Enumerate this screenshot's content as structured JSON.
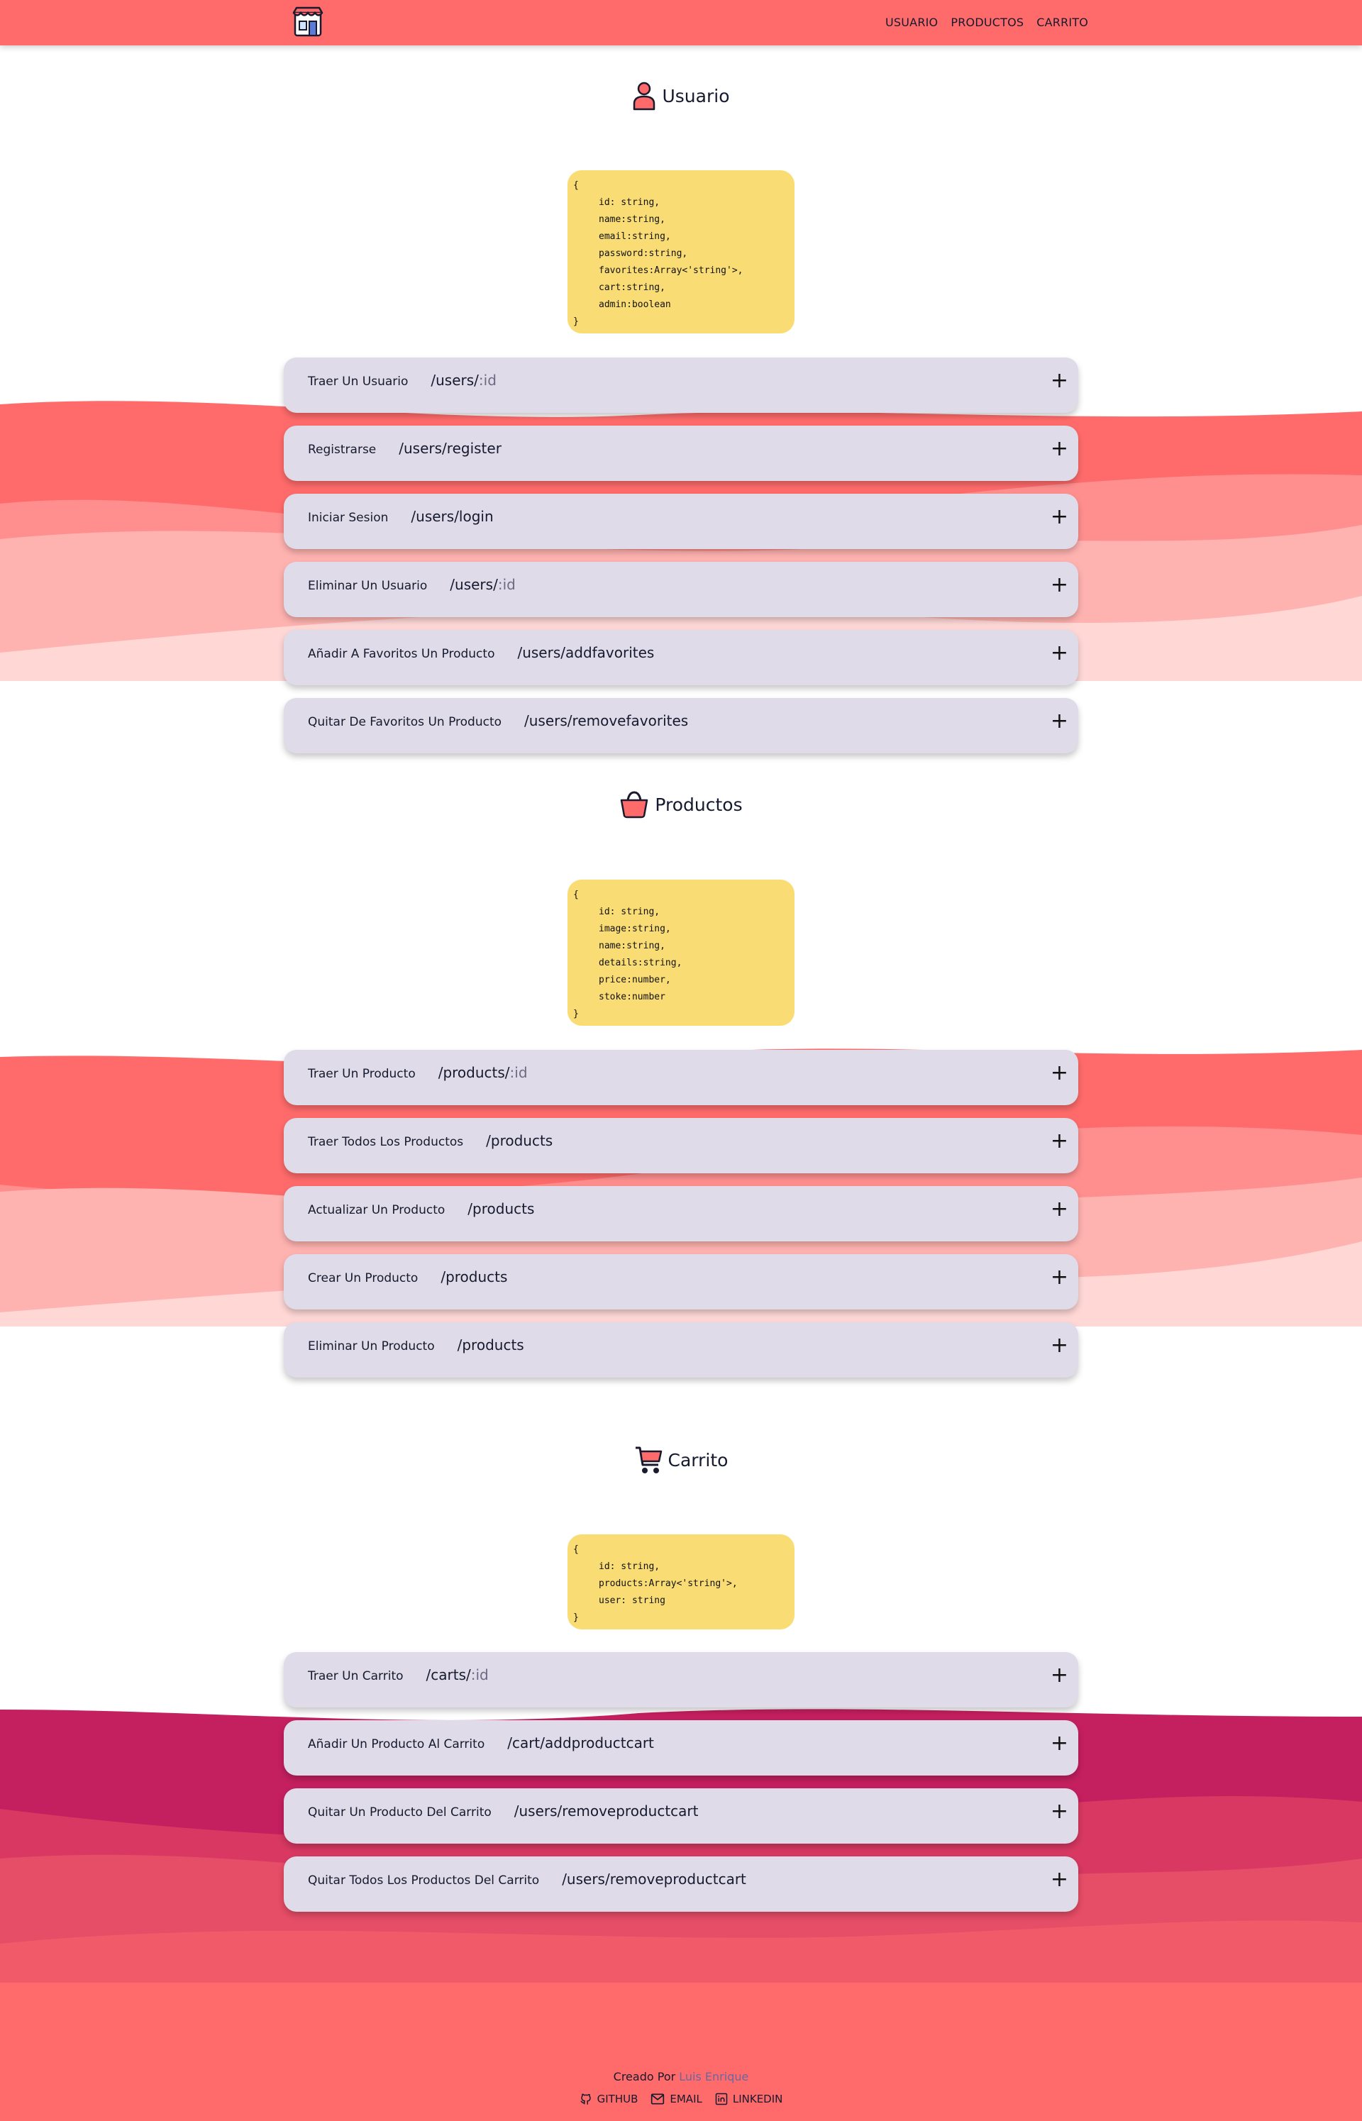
{
  "nav": {
    "logo_alt": "store-logo",
    "items": [
      "USUARIO",
      "PRODUCTOS",
      "CARRITO"
    ]
  },
  "sections": {
    "usuario": {
      "title": "Usuario",
      "schema": [
        "id: string,",
        "name:string,",
        "email:string,",
        "password:string,",
        "favorites:Array<'string'>,",
        "cart:string,",
        "admin:boolean"
      ],
      "endpoints": [
        {
          "name": "Traer Un Usuario",
          "path": "/users/",
          "param": ":id"
        },
        {
          "name": "Registrarse",
          "path": "/users/register",
          "param": ""
        },
        {
          "name": "Iniciar Sesion",
          "path": "/users/login",
          "param": ""
        },
        {
          "name": "Eliminar Un Usuario",
          "path": "/users/",
          "param": ":id"
        },
        {
          "name": "Añadir A Favoritos Un Producto",
          "path": "/users/addfavorites",
          "param": ""
        },
        {
          "name": "Quitar De Favoritos Un Producto",
          "path": "/users/removefavorites",
          "param": ""
        }
      ]
    },
    "productos": {
      "title": "Productos",
      "schema": [
        "id: string,",
        "image:string,",
        "name:string,",
        "details:string,",
        "price:number,",
        "stoke:number"
      ],
      "endpoints": [
        {
          "name": "Traer Un Producto",
          "path": "/products/",
          "param": ":id"
        },
        {
          "name": "Traer Todos Los Productos",
          "path": "/products",
          "param": ""
        },
        {
          "name": "Actualizar Un Producto",
          "path": "/products",
          "param": ""
        },
        {
          "name": "Crear Un Producto",
          "path": "/products",
          "param": ""
        },
        {
          "name": "Eliminar Un Producto",
          "path": "/products",
          "param": ""
        }
      ]
    },
    "carrito": {
      "title": "Carrito",
      "schema": [
        "id: string,",
        "products:Array<'string'>,",
        "user: string"
      ],
      "endpoints": [
        {
          "name": "Traer Un Carrito",
          "path": "/carts/",
          "param": ":id"
        },
        {
          "name": "Añadir Un Producto Al Carrito",
          "path": "/cart/addproductcart",
          "param": ""
        },
        {
          "name": "Quitar Un Producto Del Carrito",
          "path": "/users/removeproductcart",
          "param": ""
        },
        {
          "name": "Quitar Todos Los Productos Del Carrito",
          "path": "/users/removeproductcart",
          "param": ""
        }
      ]
    }
  },
  "code": {
    "open": "{",
    "close": "}"
  },
  "expand_symbol": "+",
  "footer": {
    "created_by": "Creado Por",
    "author": "Luis Enrique",
    "links": [
      "GITHUB",
      "EMAIL",
      "LINKEDIN"
    ]
  },
  "colors": {
    "header": "#ff6b6b",
    "card": "#e0dbe8",
    "code": "#f9dc74",
    "wave_red": "#ff6b6b",
    "wave_magenta": "#c41f5f"
  }
}
